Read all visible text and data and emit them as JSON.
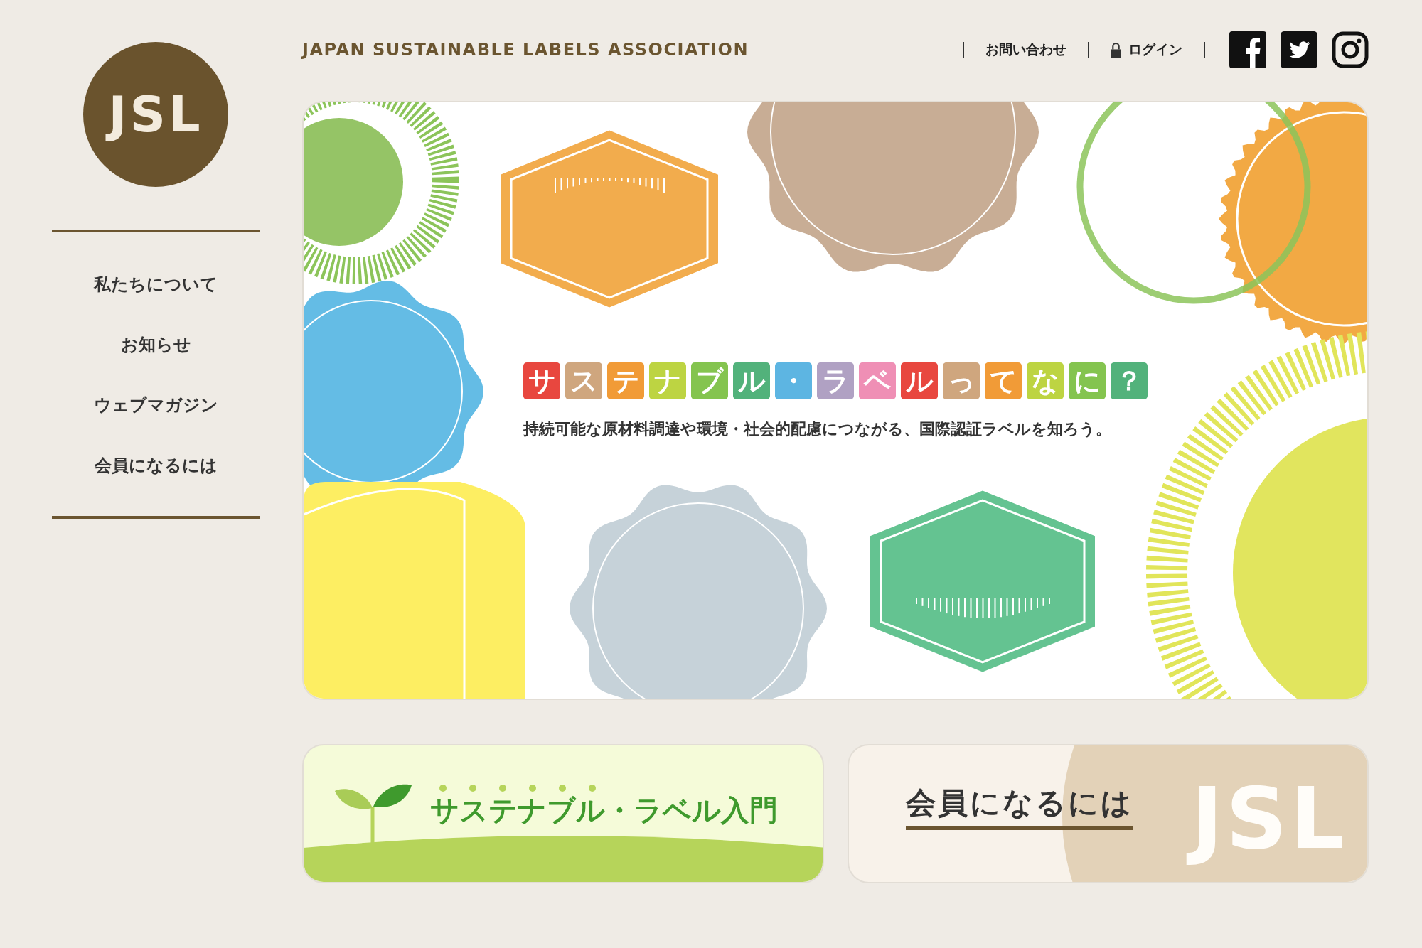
{
  "logo": {
    "text": "JSL"
  },
  "header": {
    "title": "JAPAN SUSTAINABLE LABELS ASSOCIATION",
    "links": [
      {
        "kind": "text",
        "label": "お問い合わせ"
      },
      {
        "kind": "login",
        "label": "ログイン"
      }
    ]
  },
  "nav": [
    {
      "label": "私たちについて"
    },
    {
      "label": "お知らせ"
    },
    {
      "label": "ウェブマガジン"
    },
    {
      "label": "会員になるには"
    }
  ],
  "hero": {
    "title_tiles": [
      {
        "char": "サ",
        "color": "#e8473f"
      },
      {
        "char": "ス",
        "color": "#cfa67e"
      },
      {
        "char": "テ",
        "color": "#f19b37"
      },
      {
        "char": "ナ",
        "color": "#bdd442"
      },
      {
        "char": "ブ",
        "color": "#84c44f"
      },
      {
        "char": "ル",
        "color": "#52b27b"
      },
      {
        "char": "・",
        "color": "#5db5e2"
      },
      {
        "char": "ラ",
        "color": "#b0a1c3"
      },
      {
        "char": "ベ",
        "color": "#ef8fb5"
      },
      {
        "char": "ル",
        "color": "#e8473f"
      },
      {
        "char": "っ",
        "color": "#cfa67e"
      },
      {
        "char": "て",
        "color": "#f19b37"
      },
      {
        "char": "な",
        "color": "#bdd442"
      },
      {
        "char": "に",
        "color": "#84c44f"
      },
      {
        "char": "？",
        "color": "#52b27b"
      }
    ],
    "subtitle": "持続可能な原材料調達や環境・社会的配慮につながる、国際認証ラベルを知ろう。"
  },
  "banners": [
    {
      "kind": "intro",
      "title": "サステナブル・ラベル入門"
    },
    {
      "kind": "member",
      "title": "会員になるには",
      "watermark": "JSL"
    }
  ]
}
